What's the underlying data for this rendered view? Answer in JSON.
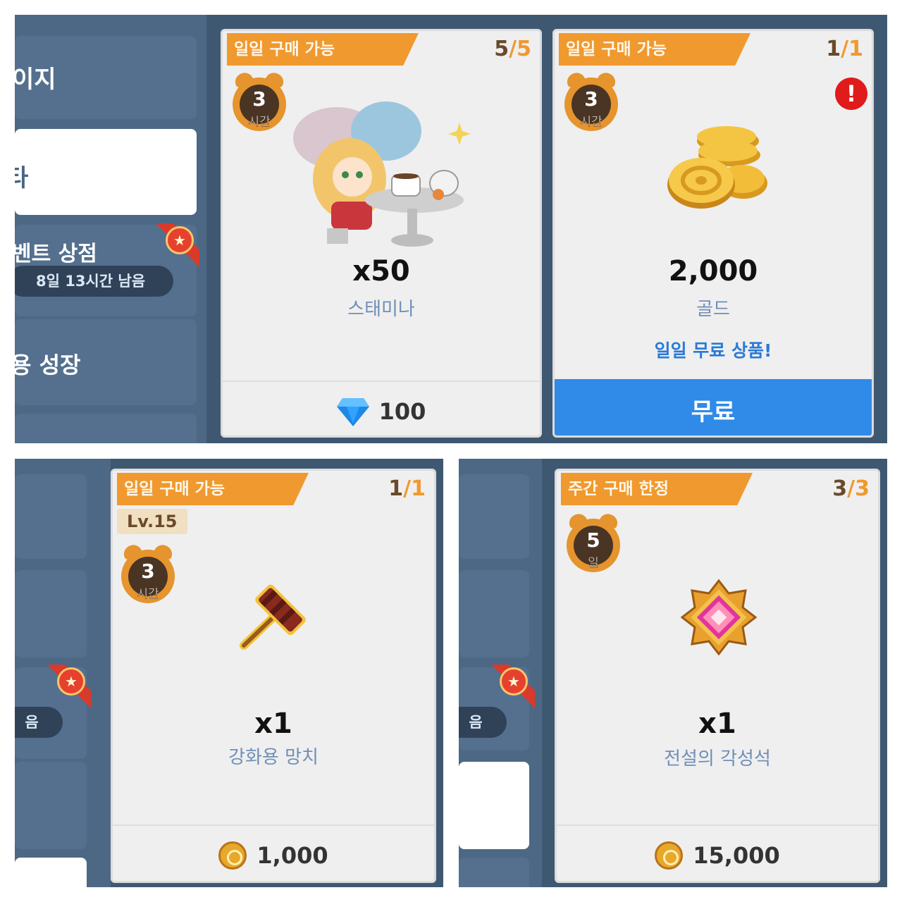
{
  "sidebar": {
    "item1_label": "이지",
    "item2_label": "타",
    "event_shop_label": "벤트 상점",
    "event_shop_remaining": "8일 13시간 남음",
    "growth_label": "용 성장",
    "remaining_fragment": "음",
    "star_icon": "★"
  },
  "cards": [
    {
      "tag": "일일 구매 가능",
      "count_current": "5",
      "count_max": "5",
      "timer_value": "3",
      "timer_unit": "시간",
      "image": "stamina-character-illustration",
      "quantity": "x50",
      "name": "스태미나",
      "price": "100",
      "currency": "diamond"
    },
    {
      "tag": "일일 구매 가능",
      "count_current": "1",
      "count_max": "1",
      "timer_value": "3",
      "timer_unit": "시간",
      "image": "gold-coins-pile",
      "quantity": "2,000",
      "name": "골드",
      "promo": "일일 무료 상품!",
      "button_label": "무료",
      "alert_icon": "!"
    },
    {
      "tag": "일일 구매 가능",
      "count_current": "1",
      "count_max": "1",
      "level_badge": "Lv.15",
      "timer_value": "3",
      "timer_unit": "시간",
      "image": "enhancement-hammer",
      "quantity": "x1",
      "name": "강화용 망치",
      "price": "1,000",
      "currency": "gold-coin"
    },
    {
      "tag": "주간 구매 한정",
      "count_current": "3",
      "count_max": "3",
      "timer_value": "5",
      "timer_unit": "일",
      "image": "legendary-awakening-stone",
      "quantity": "x1",
      "name": "전설의 각성석",
      "price": "15,000",
      "currency": "gold-coin"
    }
  ],
  "colors": {
    "tag_orange": "#f0992e",
    "free_button_blue": "#2f8ae8",
    "item_name_blue": "#6f8fb7",
    "sidebar_navy": "#4d6885"
  }
}
